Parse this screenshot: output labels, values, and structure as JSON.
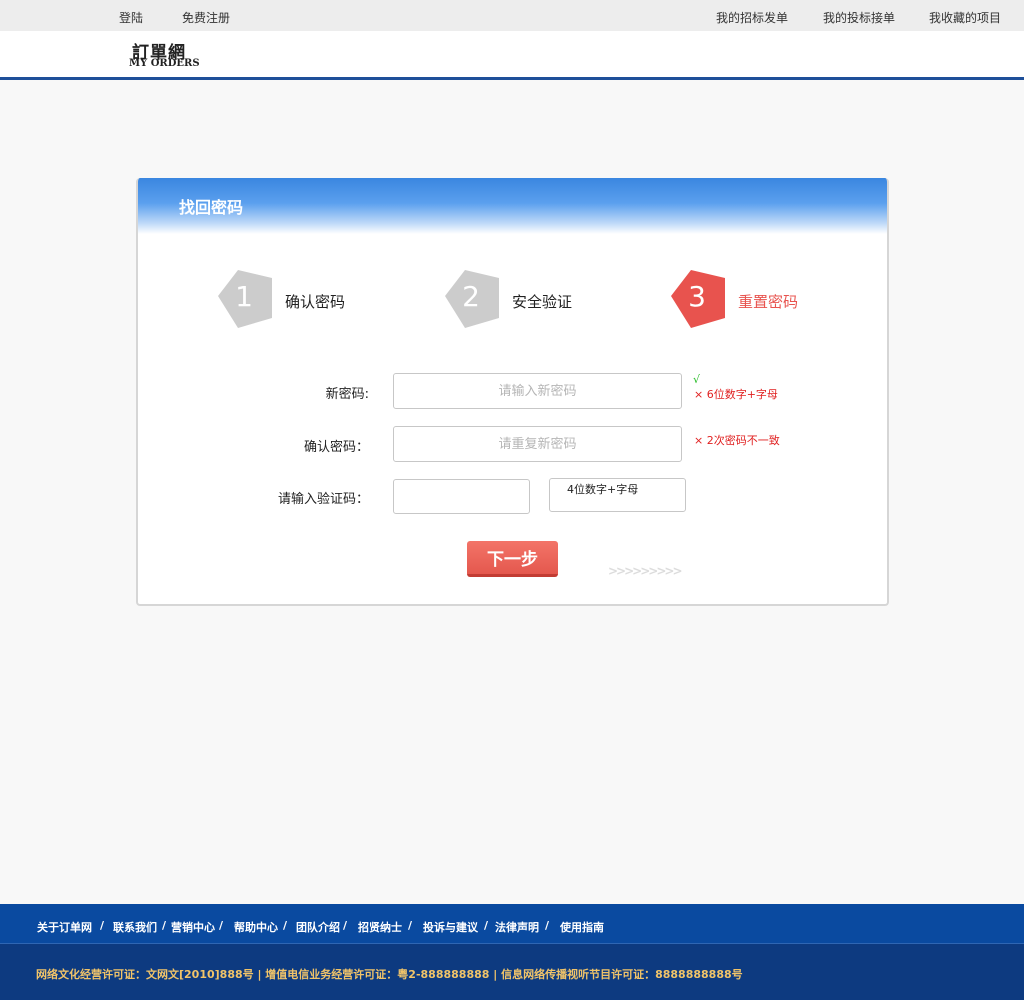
{
  "topbar": {
    "login": "登陆",
    "register": "免费注册",
    "my_bids_posted": "我的招标发单",
    "my_bids_taken": "我的投标接单",
    "my_favorites": "我收藏的项目"
  },
  "logo": {
    "chinese": "訂單網",
    "english": "MY ORDERS"
  },
  "panel": {
    "title": "找回密码"
  },
  "steps": [
    {
      "number": "1",
      "label": "确认密码",
      "state": "done",
      "color": "#cccccc"
    },
    {
      "number": "2",
      "label": "安全验证",
      "state": "done",
      "color": "#cccccc"
    },
    {
      "number": "3",
      "label": "重置密码",
      "state": "active",
      "color": "#e8534e"
    }
  ],
  "form": {
    "new_password": {
      "label": "新密码:",
      "placeholder": "请输入新密码",
      "ok_mark": "√",
      "error": "×  6位数字+字母"
    },
    "confirm_password": {
      "label": "确认密码：",
      "placeholder": "请重复新密码",
      "error": "× 2次密码不一致"
    },
    "captcha": {
      "label": "请输入验证码：",
      "value": "",
      "code_text": "4位数字+字母"
    },
    "next_button": "下一步",
    "chevrons": ">>>>>>>>>"
  },
  "footer": {
    "links": [
      "关于订单网",
      "联系我们",
      "营销中心",
      "帮助中心",
      "团队介绍",
      "招贤纳士",
      "投诉与建议",
      "法律声明",
      "使用指南"
    ],
    "separator": "/",
    "license": "网络文化经营许可证：文网文[2010]888号 | 增值电信业务经营许可证：粤2-888888888 | 信息网络传播视听节目许可证：8888888888号"
  },
  "colors": {
    "header_rule": "#1e4f99",
    "panel_header": "#3a86e0",
    "accent_red": "#e8534e",
    "step_gray": "#cccccc",
    "footer_links_bg": "#0a4aa0",
    "footer_bottom_bg": "#0d3a80",
    "license_text": "#f1c469"
  }
}
